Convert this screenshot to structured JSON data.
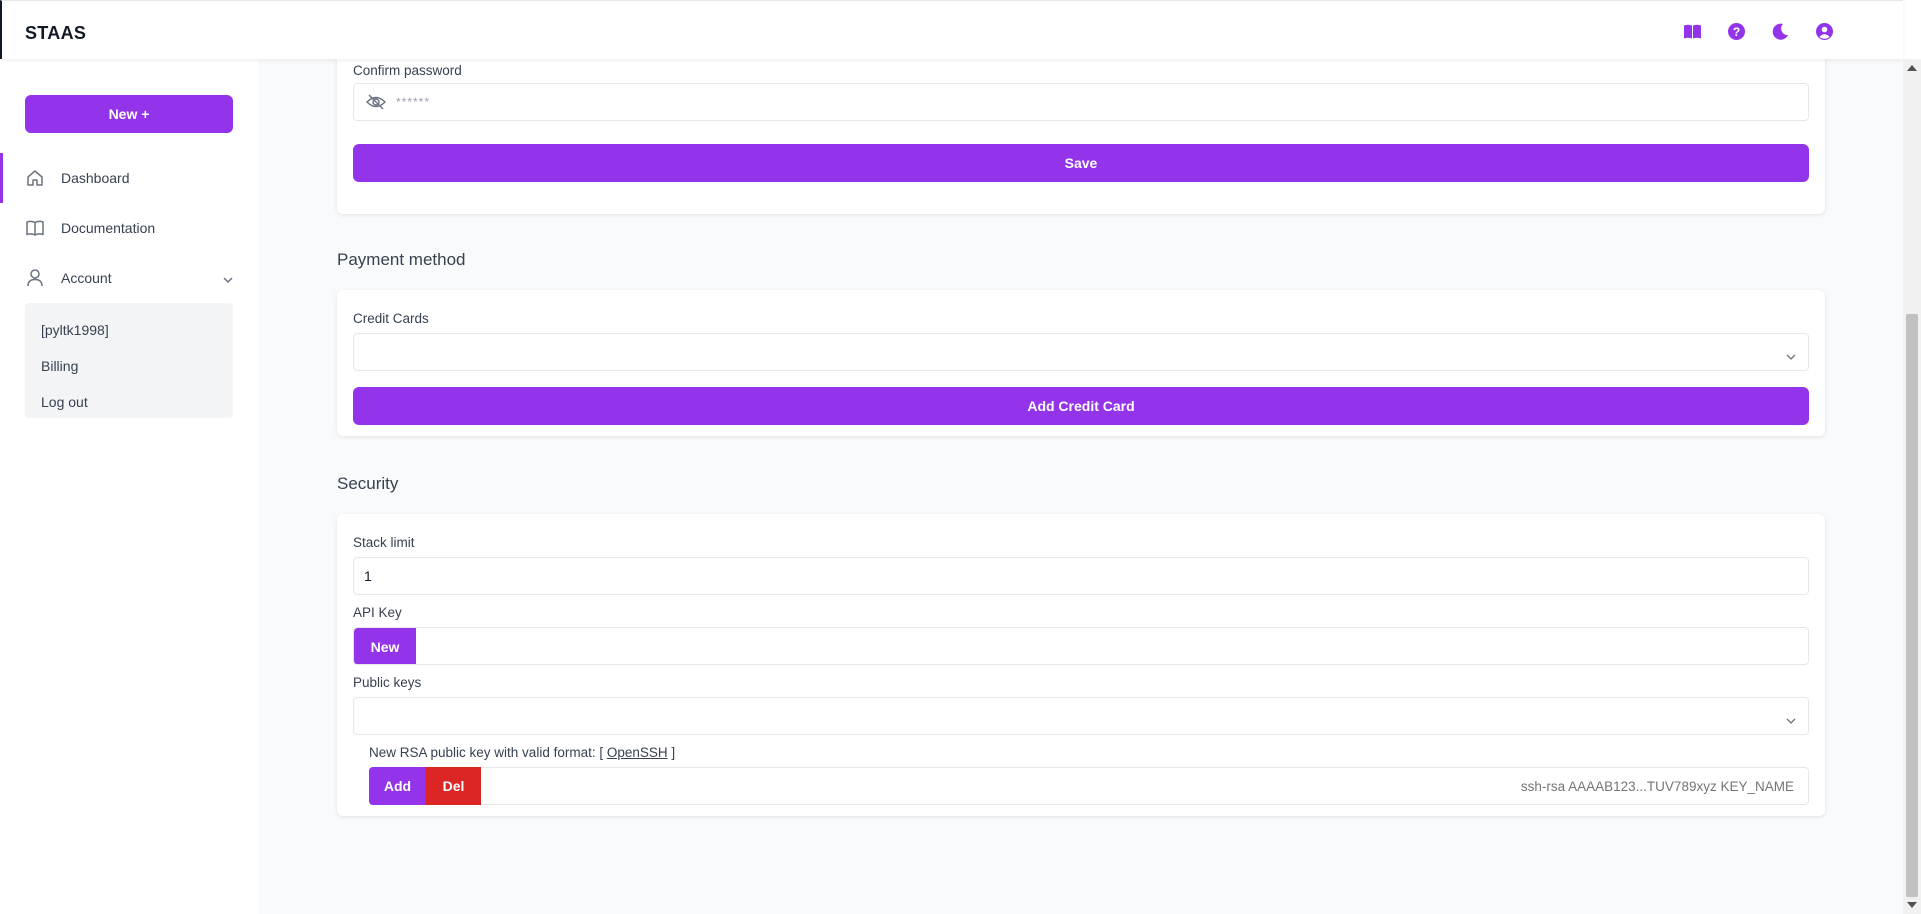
{
  "app": {
    "brand": "STAAS"
  },
  "header": {
    "icons": [
      "book-icon",
      "help-icon",
      "moon-icon",
      "user-icon"
    ],
    "accent": "#9333ea"
  },
  "sidebar": {
    "new_button": "New  +",
    "items": [
      {
        "label": "Dashboard",
        "icon": "home-icon",
        "active": true
      },
      {
        "label": "Documentation",
        "icon": "book-open-icon"
      },
      {
        "label": "Account",
        "icon": "user-icon",
        "expanded": true
      }
    ],
    "account_submenu": [
      "[pyltk1998]",
      "Billing",
      "Log out"
    ]
  },
  "password": {
    "confirm_label": "Confirm password",
    "confirm_placeholder": "******",
    "save_label": "Save"
  },
  "payment": {
    "title": "Payment method",
    "credit_cards_label": "Credit Cards",
    "credit_cards_value": "",
    "add_card_label": "Add Credit Card"
  },
  "security": {
    "title": "Security",
    "stack_limit_label": "Stack limit",
    "stack_limit_value": "1",
    "api_key_label": "API Key",
    "api_new_label": "New",
    "api_key_value": "",
    "public_keys_label": "Public keys",
    "public_keys_value": "",
    "rsa_hint_prefix": "New RSA public key with valid format: [ ",
    "rsa_hint_link": "OpenSSH",
    "rsa_hint_suffix": " ]",
    "add_label": "Add",
    "del_label": "Del",
    "rsa_placeholder": "ssh-rsa AAAAB123...TUV789xyz KEY_NAME"
  },
  "colors": {
    "primary": "#9333ea",
    "danger": "#dc2626",
    "background": "#f9fafb"
  }
}
